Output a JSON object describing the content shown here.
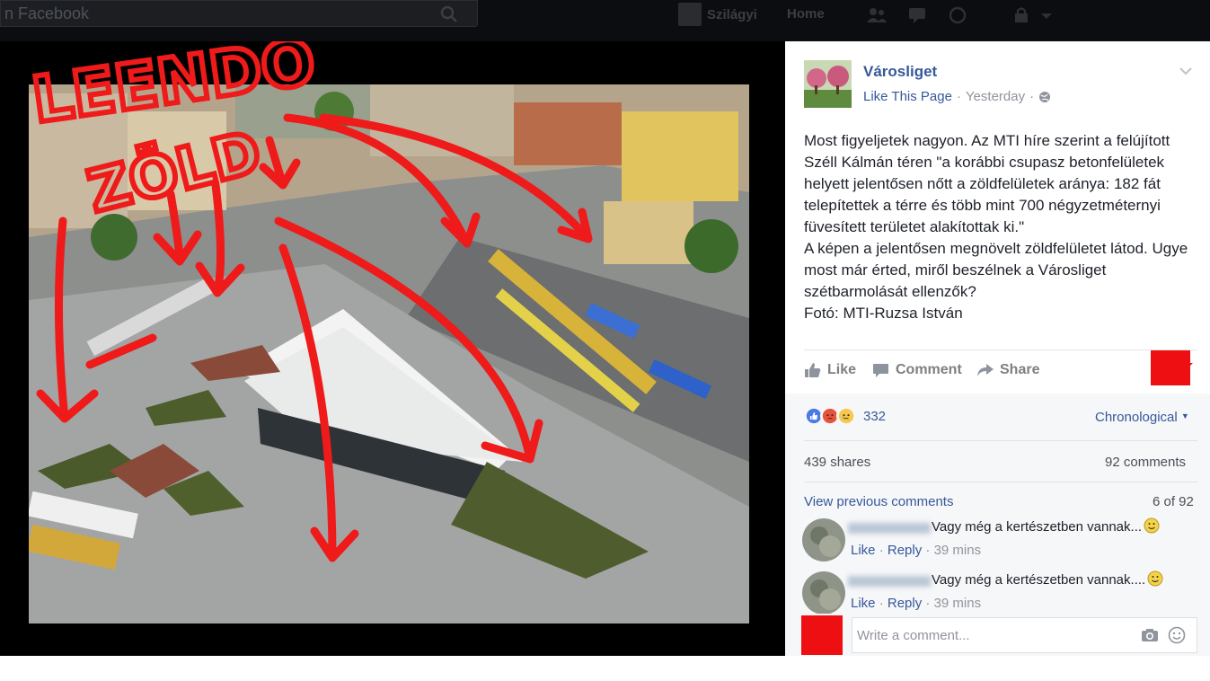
{
  "topbar": {
    "search_placeholder": "n Facebook",
    "profile_name": "Szilágyi",
    "home_label": "Home",
    "icons": [
      "search-icon",
      "friends-icon",
      "messages-icon",
      "globe-icon",
      "lock-icon",
      "chevron-down-icon"
    ]
  },
  "photo": {
    "annotation_line1": "LEENDŐ",
    "annotation_line2": "ZÖLD",
    "annotation_color": "#ef1a1a"
  },
  "post": {
    "page_name": "Városliget",
    "like_page": "Like This Page",
    "dot": "·",
    "time": "Yesterday",
    "text": "Most figyeljetek nagyon. Az MTI híre szerint a felújított Széll Kálmán téren \"a korábbi csupasz betonfelületek helyett jelentősen nőtt a zöldfelületek aránya: 182 fát telepítettek a térre és több mint 700 négyzetméternyi füvesített területet alakítottak ki.\"\nA képen a jelentősen megnövelt zöldfelületet látod. Ugye most már érted, miről beszélnek a Városliget szétbarmolását ellenzők?\nFotó: MTI-Ruzsa István"
  },
  "actions": {
    "like": "Like",
    "comment": "Comment",
    "share": "Share"
  },
  "stats": {
    "reaction_count": "332",
    "sort_label": "Chronological",
    "sort_caret": "▼",
    "shares": "439 shares",
    "comments": "92 comments",
    "view_previous": "View previous comments",
    "page_of": "6 of 92"
  },
  "comments": [
    {
      "text": "Vagy még a kertészetben vannak...",
      "like": "Like",
      "reply": "Reply",
      "dot": "·",
      "time": "39 mins"
    },
    {
      "text": "Vagy még a kertészetben vannak....",
      "like": "Like",
      "reply": "Reply",
      "dot": "·",
      "time": "39 mins"
    }
  ],
  "composer": {
    "placeholder": "Write a comment..."
  },
  "colors": {
    "link_blue": "#365899",
    "redaction_red": "#ee0f12",
    "topbar_bg": "#0c0d10"
  }
}
